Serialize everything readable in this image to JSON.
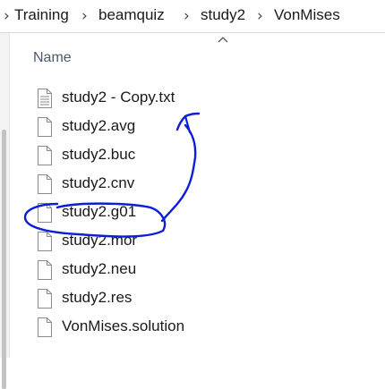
{
  "breadcrumb": {
    "items": [
      "Training",
      "beamquiz",
      "study2",
      "VonMises"
    ],
    "separator": "›"
  },
  "file_list": {
    "column_name": "Name",
    "sort_indicator": "ascending",
    "files": [
      {
        "name": "study2 - Copy.txt",
        "icon": "text-file-icon"
      },
      {
        "name": "study2.avg",
        "icon": "file-icon"
      },
      {
        "name": "study2.buc",
        "icon": "file-icon"
      },
      {
        "name": "study2.cnv",
        "icon": "file-icon"
      },
      {
        "name": "study2.g01",
        "icon": "file-icon"
      },
      {
        "name": "study2.mor",
        "icon": "file-icon"
      },
      {
        "name": "study2.neu",
        "icon": "file-icon"
      },
      {
        "name": "study2.res",
        "icon": "file-icon"
      },
      {
        "name": "VonMises.solution",
        "icon": "file-icon"
      }
    ]
  },
  "colors": {
    "annotation_ink": "#0a1fd6",
    "header_text": "#4b5a6b"
  }
}
